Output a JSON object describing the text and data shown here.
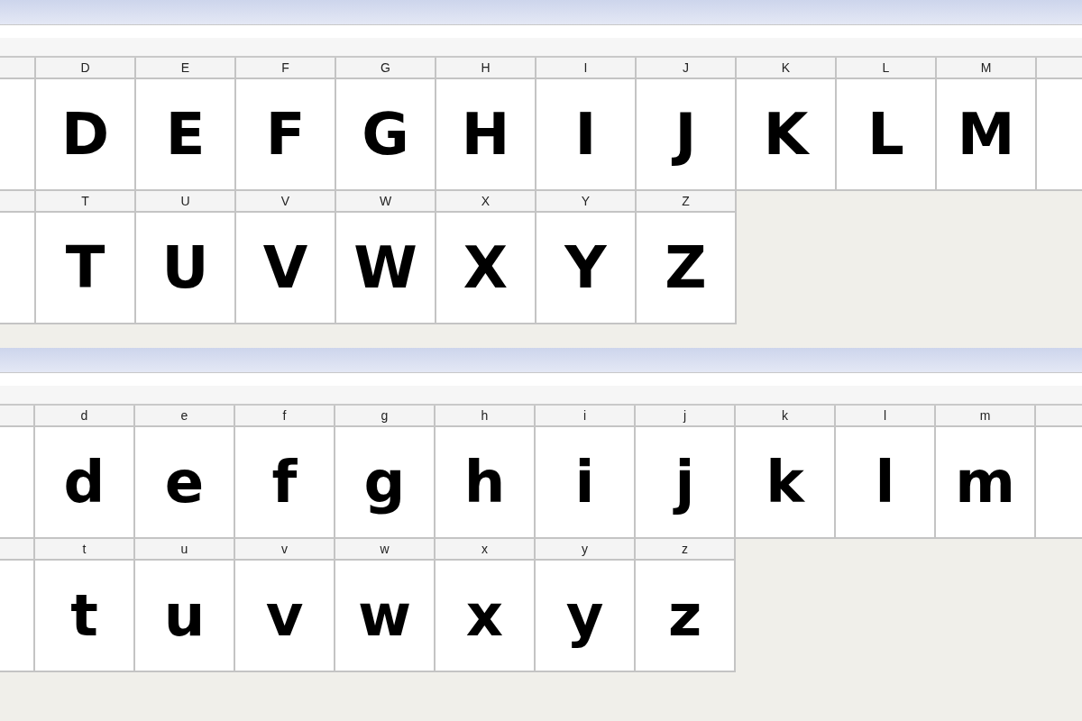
{
  "panels": [
    {
      "rows": [
        {
          "cells": [
            {
              "kind": "partial"
            },
            {
              "kind": "char",
              "header": "D",
              "glyph": "D"
            },
            {
              "kind": "char",
              "header": "E",
              "glyph": "E"
            },
            {
              "kind": "char",
              "header": "F",
              "glyph": "F"
            },
            {
              "kind": "char",
              "header": "G",
              "glyph": "G"
            },
            {
              "kind": "char",
              "header": "H",
              "glyph": "H"
            },
            {
              "kind": "char",
              "header": "I",
              "glyph": "I"
            },
            {
              "kind": "char",
              "header": "J",
              "glyph": "J"
            },
            {
              "kind": "char",
              "header": "K",
              "glyph": "K"
            },
            {
              "kind": "char",
              "header": "L",
              "glyph": "L"
            },
            {
              "kind": "char",
              "header": "M",
              "glyph": "M"
            },
            {
              "kind": "partial"
            }
          ]
        },
        {
          "cells": [
            {
              "kind": "partial"
            },
            {
              "kind": "char",
              "header": "T",
              "glyph": "T"
            },
            {
              "kind": "char",
              "header": "U",
              "glyph": "U"
            },
            {
              "kind": "char",
              "header": "V",
              "glyph": "V"
            },
            {
              "kind": "char",
              "header": "W",
              "glyph": "W"
            },
            {
              "kind": "char",
              "header": "X",
              "glyph": "X"
            },
            {
              "kind": "char",
              "header": "Y",
              "glyph": "Y"
            },
            {
              "kind": "char",
              "header": "Z",
              "glyph": "Z"
            }
          ]
        }
      ]
    },
    {
      "rows": [
        {
          "cells": [
            {
              "kind": "partial"
            },
            {
              "kind": "char",
              "header": "d",
              "glyph": "d"
            },
            {
              "kind": "char",
              "header": "e",
              "glyph": "e"
            },
            {
              "kind": "char",
              "header": "f",
              "glyph": "f"
            },
            {
              "kind": "char",
              "header": "g",
              "glyph": "g"
            },
            {
              "kind": "char",
              "header": "h",
              "glyph": "h"
            },
            {
              "kind": "char",
              "header": "i",
              "glyph": "i"
            },
            {
              "kind": "char",
              "header": "j",
              "glyph": "j"
            },
            {
              "kind": "char",
              "header": "k",
              "glyph": "k"
            },
            {
              "kind": "char",
              "header": "l",
              "glyph": "l"
            },
            {
              "kind": "char",
              "header": "m",
              "glyph": "m"
            },
            {
              "kind": "partial"
            }
          ]
        },
        {
          "cells": [
            {
              "kind": "partial"
            },
            {
              "kind": "char",
              "header": "t",
              "glyph": "t"
            },
            {
              "kind": "char",
              "header": "u",
              "glyph": "u"
            },
            {
              "kind": "char",
              "header": "v",
              "glyph": "v"
            },
            {
              "kind": "char",
              "header": "w",
              "glyph": "w"
            },
            {
              "kind": "char",
              "header": "x",
              "glyph": "x"
            },
            {
              "kind": "char",
              "header": "y",
              "glyph": "y"
            },
            {
              "kind": "char",
              "header": "z",
              "glyph": "z"
            }
          ]
        }
      ]
    }
  ]
}
